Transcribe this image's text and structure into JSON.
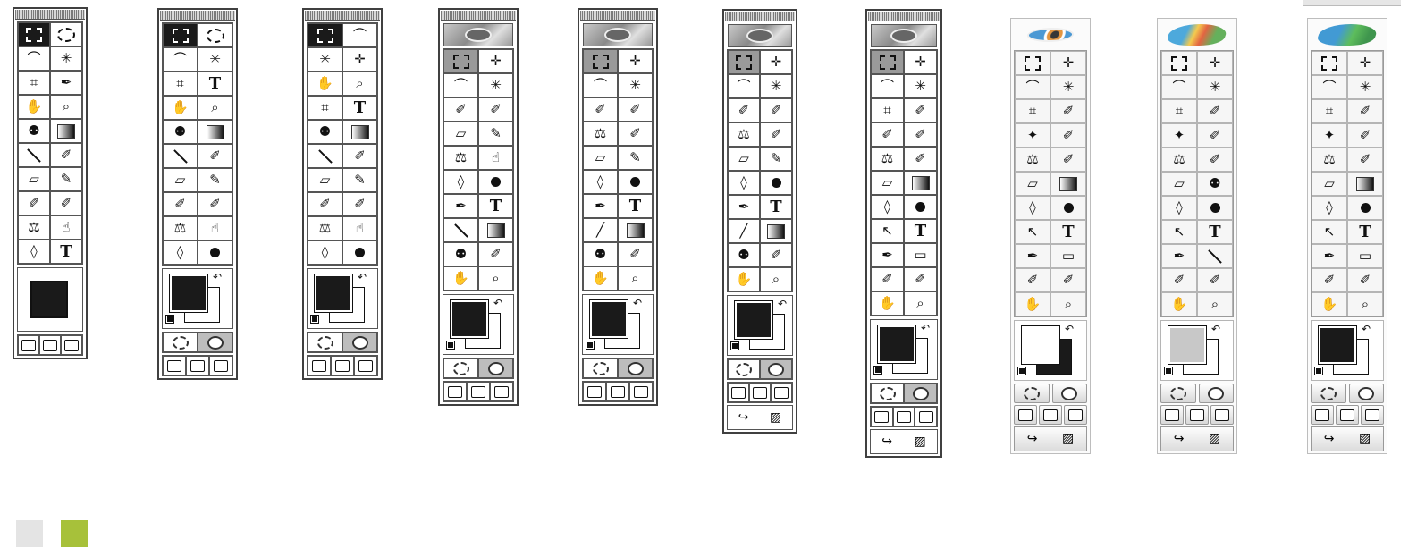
{
  "palettes": [
    {
      "id": "p1",
      "variant": "classic",
      "header": "none",
      "rows": [
        [
          "marquee",
          "ellipse"
        ],
        [
          "lasso",
          "magic-wand"
        ],
        [
          "crop",
          "pen"
        ],
        [
          "hand",
          "zoom"
        ],
        [
          "bucket",
          "gradient"
        ],
        [
          "line",
          "eyedropper"
        ],
        [
          "eraser",
          "pencil"
        ],
        [
          "airbrush",
          "paintbrush"
        ],
        [
          "stamp",
          "smudge"
        ],
        [
          "drop",
          "T"
        ]
      ],
      "colorbox": "single",
      "extras": [
        "screens"
      ]
    },
    {
      "id": "p2",
      "variant": "classic",
      "header": "none",
      "rows": [
        [
          "marquee",
          "ellipse"
        ],
        [
          "lasso",
          "magic-wand"
        ],
        [
          "crop",
          "T"
        ],
        [
          "hand",
          "zoom"
        ],
        [
          "bucket",
          "gradient"
        ],
        [
          "line",
          "eyedropper"
        ],
        [
          "eraser",
          "pencil"
        ],
        [
          "airbrush",
          "paintbrush"
        ],
        [
          "stamp",
          "smudge"
        ],
        [
          "drop",
          "dodge"
        ]
      ],
      "colorbox": "pair",
      "extras": [
        "modes",
        "screens"
      ]
    },
    {
      "id": "p3",
      "variant": "classic",
      "header": "none",
      "rows": [
        [
          "marquee",
          "lasso"
        ],
        [
          "magic-wand",
          "move"
        ],
        [
          "hand",
          "zoom"
        ],
        [
          "crop",
          "T"
        ],
        [
          "bucket",
          "gradient"
        ],
        [
          "line",
          "eyedropper"
        ],
        [
          "eraser",
          "pencil"
        ],
        [
          "airbrush",
          "paintbrush"
        ],
        [
          "stamp",
          "smudge"
        ],
        [
          "drop",
          "dodge"
        ]
      ],
      "colorbox": "pair",
      "extras": [
        "modes",
        "screens"
      ]
    },
    {
      "id": "p4",
      "variant": "classic",
      "header": "eye",
      "rows": [
        [
          "marquee",
          "move"
        ],
        [
          "lasso",
          "magic-wand"
        ],
        [
          "airbrush",
          "paintbrush"
        ],
        [
          "eraser",
          "pencil"
        ],
        [
          "stamp",
          "smudge"
        ],
        [
          "drop",
          "dodge"
        ],
        [
          "pen",
          "T"
        ],
        [
          "line",
          "gradient"
        ],
        [
          "bucket",
          "eyedropper"
        ],
        [
          "hand",
          "zoom"
        ]
      ],
      "colorbox": "pair",
      "extras": [
        "modes",
        "screens"
      ]
    },
    {
      "id": "p5",
      "variant": "classic",
      "header": "eye",
      "rows": [
        [
          "marquee",
          "move"
        ],
        [
          "lasso",
          "magic-wand"
        ],
        [
          "airbrush",
          "paintbrush"
        ],
        [
          "stamp",
          "history-brush"
        ],
        [
          "eraser",
          "pencil"
        ],
        [
          "drop",
          "dodge"
        ],
        [
          "pen",
          "T"
        ],
        [
          "measure",
          "gradient"
        ],
        [
          "bucket",
          "eyedropper"
        ],
        [
          "hand",
          "zoom"
        ]
      ],
      "colorbox": "pair",
      "extras": [
        "modes",
        "screens"
      ]
    },
    {
      "id": "p6",
      "variant": "classic",
      "header": "eye",
      "rows": [
        [
          "marquee",
          "move"
        ],
        [
          "lasso",
          "magic-wand"
        ],
        [
          "airbrush",
          "paintbrush"
        ],
        [
          "stamp",
          "history-brush"
        ],
        [
          "eraser",
          "pencil"
        ],
        [
          "drop",
          "dodge"
        ],
        [
          "pen",
          "T"
        ],
        [
          "measure",
          "gradient"
        ],
        [
          "bucket",
          "eyedropper"
        ],
        [
          "hand",
          "zoom"
        ]
      ],
      "colorbox": "pair",
      "extras": [
        "modes",
        "screens",
        "jump"
      ]
    },
    {
      "id": "p7",
      "variant": "classic",
      "header": "eye",
      "rows": [
        [
          "marquee",
          "move"
        ],
        [
          "lasso",
          "magic-wand"
        ],
        [
          "crop",
          "slice"
        ],
        [
          "airbrush",
          "paintbrush"
        ],
        [
          "stamp",
          "history-brush"
        ],
        [
          "eraser",
          "gradient"
        ],
        [
          "drop",
          "dodge"
        ],
        [
          "arrow",
          "T"
        ],
        [
          "pen",
          "rectangle"
        ],
        [
          "notes",
          "eyedropper"
        ],
        [
          "hand",
          "zoom"
        ]
      ],
      "colorbox": "pair",
      "extras": [
        "modes",
        "screens",
        "jump"
      ]
    },
    {
      "id": "p8",
      "variant": "modern",
      "header": "logo-eye",
      "rows": [
        [
          "marquee",
          "move"
        ],
        [
          "lasso",
          "magic-wand"
        ],
        [
          "crop",
          "slice"
        ],
        [
          "healing",
          "paintbrush"
        ],
        [
          "stamp",
          "history-brush"
        ],
        [
          "eraser",
          "gradient"
        ],
        [
          "drop",
          "dodge"
        ],
        [
          "arrow",
          "T"
        ],
        [
          "pen",
          "rectangle"
        ],
        [
          "notes",
          "eyedropper"
        ],
        [
          "hand",
          "zoom"
        ]
      ],
      "colorbox": "pair-inverse",
      "extras": [
        "modes",
        "screens",
        "jump"
      ]
    },
    {
      "id": "p9",
      "variant": "modern",
      "header": "logo-feather",
      "rows": [
        [
          "marquee",
          "move"
        ],
        [
          "lasso",
          "magic-wand"
        ],
        [
          "crop",
          "slice"
        ],
        [
          "healing",
          "paintbrush"
        ],
        [
          "stamp",
          "history-brush"
        ],
        [
          "eraser",
          "bucket"
        ],
        [
          "drop",
          "dodge"
        ],
        [
          "arrow",
          "T"
        ],
        [
          "pen",
          "line"
        ],
        [
          "notes",
          "eyedropper"
        ],
        [
          "hand",
          "zoom"
        ]
      ],
      "colorbox": "pair-gray",
      "extras": [
        "modes",
        "screens",
        "jump"
      ]
    },
    {
      "id": "p10",
      "variant": "modern",
      "header": "logo-feather2",
      "rows": [
        [
          "marquee",
          "move"
        ],
        [
          "lasso",
          "magic-wand"
        ],
        [
          "crop",
          "slice"
        ],
        [
          "healing",
          "paintbrush"
        ],
        [
          "stamp",
          "history-brush"
        ],
        [
          "eraser",
          "gradient"
        ],
        [
          "drop",
          "dodge"
        ],
        [
          "arrow",
          "T"
        ],
        [
          "pen",
          "rectangle"
        ],
        [
          "notes",
          "eyedropper"
        ],
        [
          "hand",
          "zoom"
        ]
      ],
      "colorbox": "pair",
      "extras": [
        "modes",
        "screens",
        "jump"
      ]
    }
  ],
  "swatches": [
    {
      "color": "#e4e4e4"
    },
    {
      "color": "#a7c13a"
    }
  ]
}
